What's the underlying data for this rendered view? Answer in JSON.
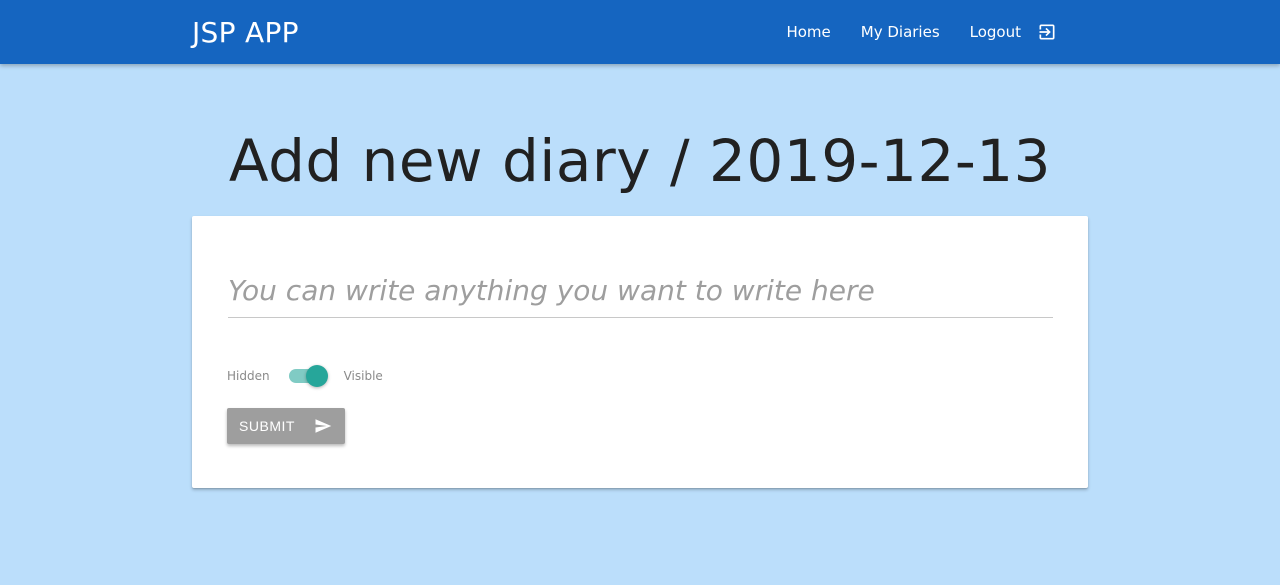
{
  "navbar": {
    "brand": "JSP APP",
    "links": [
      {
        "label": "Home"
      },
      {
        "label": "My Diaries"
      },
      {
        "label": "Logout",
        "icon": "logout-icon"
      }
    ],
    "background_color": "#1565c0"
  },
  "page": {
    "title": "Add new diary / 2019-12-13",
    "background_color": "#bbdefb"
  },
  "form": {
    "diary_input": {
      "value": "",
      "placeholder": "You can write anything you want to write here"
    },
    "visibility_switch": {
      "off_label": "Hidden",
      "on_label": "Visible",
      "checked": true,
      "accent_color": "#26a69a"
    },
    "submit": {
      "label": "SUBMIT",
      "icon": "send-icon",
      "color": "#9e9e9e"
    }
  }
}
